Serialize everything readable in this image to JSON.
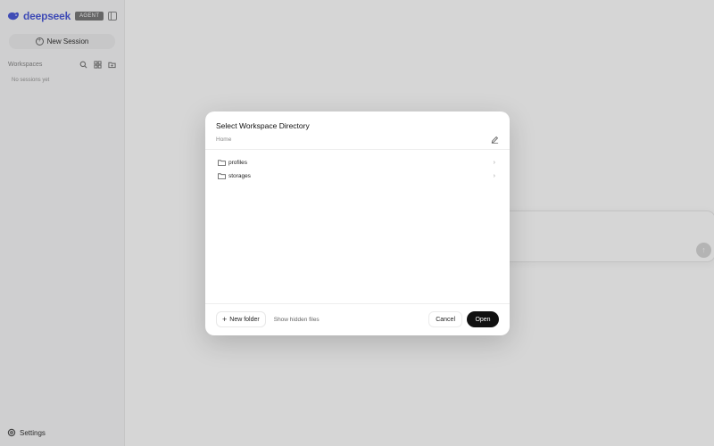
{
  "app": {
    "logo_text": "deepseek",
    "logo_badge": "AGENT",
    "new_session_label": "New Session",
    "workspace_label": "Workspaces",
    "no_sessions_text": "No sessions yet",
    "settings_label": "Settings",
    "send_icon": "arrow-up"
  },
  "dialog": {
    "title": "Select Workspace Directory",
    "breadcrumb": "Home",
    "directories": [
      {
        "name": "profiles",
        "icon": "folder-icon"
      },
      {
        "name": "storages",
        "icon": "folder-icon"
      }
    ],
    "new_folder_label": "New folder",
    "show_hidden_label": "Show hidden files",
    "cancel_label": "Cancel",
    "open_label": "Open"
  },
  "colors": {
    "brand": "#4d5bd9",
    "primary_button": "#111111",
    "overlay": "rgba(0,0,0,0.16)"
  }
}
